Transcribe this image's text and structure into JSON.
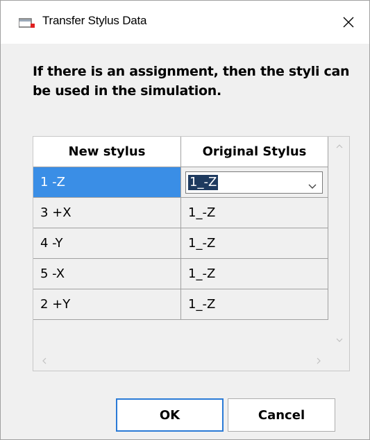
{
  "window": {
    "title": "Transfer Stylus Data"
  },
  "message": "If there is an assignment, then the styli can be used in the simulation.",
  "table": {
    "headers": [
      "New stylus",
      "Original Stylus"
    ],
    "rows": [
      {
        "new": "1 -Z",
        "original": "1_-Z"
      },
      {
        "new": "3 +X",
        "original": "1_-Z"
      },
      {
        "new": "4 -Y",
        "original": "1_-Z"
      },
      {
        "new": "5 -X",
        "original": "1_-Z"
      },
      {
        "new": "2 +Y",
        "original": "1_-Z"
      }
    ],
    "selected_row": 0
  },
  "buttons": {
    "ok": "OK",
    "cancel": "Cancel"
  },
  "icons": {
    "app": "app-icon",
    "close": "close-icon",
    "dropdown": "chevron-down-icon"
  },
  "colors": {
    "selection": "#3a8ee6",
    "ok_border": "#2a7ad6"
  }
}
